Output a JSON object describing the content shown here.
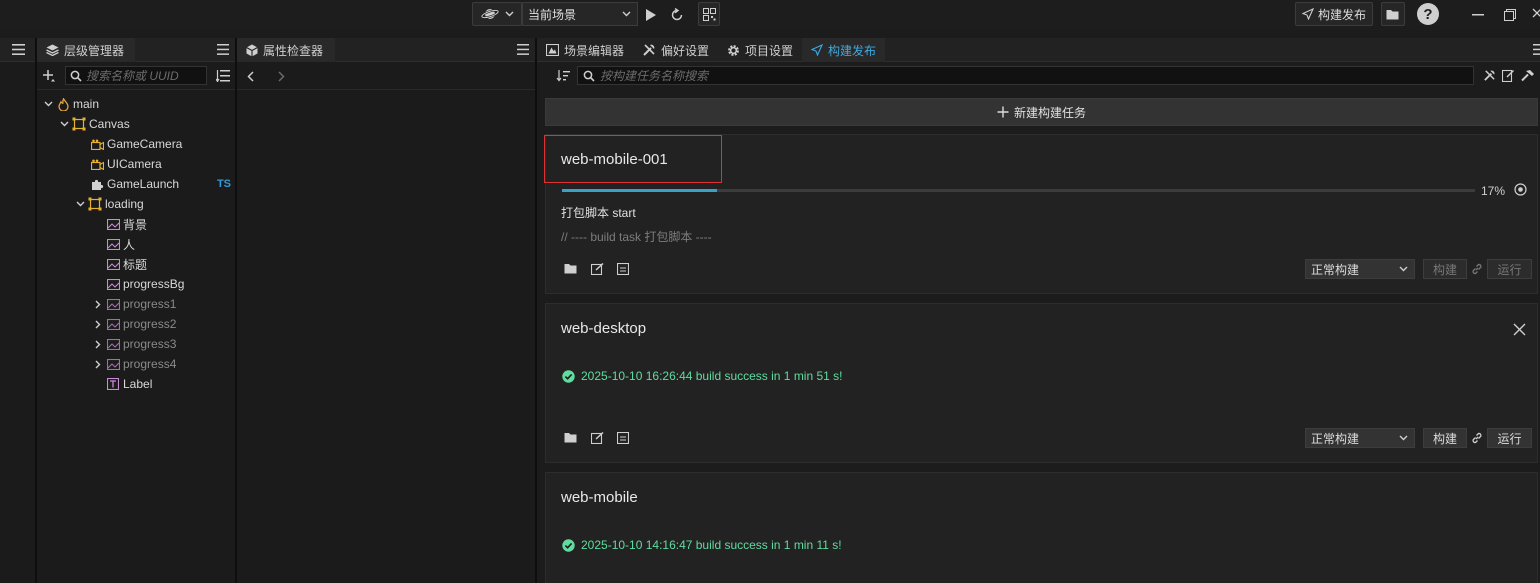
{
  "toolbar": {
    "scene_label": "当前场景",
    "build_publish_label": "构建发布"
  },
  "hierarchy": {
    "tab_label": "层级管理器",
    "search_placeholder": "搜索名称或 UUID",
    "nodes": [
      {
        "label": "main",
        "icon": "fire-icon"
      },
      {
        "label": "Canvas",
        "icon": "canvas-icon"
      },
      {
        "label": "GameCamera",
        "icon": "camera-icon"
      },
      {
        "label": "UICamera",
        "icon": "camera-icon"
      },
      {
        "label": "GameLaunch",
        "icon": "puzzle-icon",
        "badge": "TS"
      },
      {
        "label": "loading",
        "icon": "canvas-icon"
      },
      {
        "label": "背景",
        "icon": "image-icon"
      },
      {
        "label": "人",
        "icon": "image-icon"
      },
      {
        "label": "标题",
        "icon": "image-icon"
      },
      {
        "label": "progressBg",
        "icon": "image-icon"
      },
      {
        "label": "progress1",
        "icon": "image-icon"
      },
      {
        "label": "progress2",
        "icon": "image-icon"
      },
      {
        "label": "progress3",
        "icon": "image-icon"
      },
      {
        "label": "progress4",
        "icon": "image-icon"
      },
      {
        "label": "Label",
        "icon": "text-icon"
      }
    ]
  },
  "inspector": {
    "tab_label": "属性检查器"
  },
  "main_tabs": [
    {
      "label": "场景编辑器"
    },
    {
      "label": "偏好设置"
    },
    {
      "label": "项目设置"
    },
    {
      "label": "构建发布"
    }
  ],
  "build": {
    "search_placeholder": "按构建任务名称搜索",
    "new_task_label": "新建构建任务",
    "tasks": [
      {
        "name": "web-mobile-001",
        "progress_text": "17%",
        "progress": 0.17,
        "status_line": "打包脚本 start",
        "log_line": "// ---- build task 打包脚本 ----",
        "mode": "正常构建",
        "build_label": "构建",
        "run_label": "运行"
      },
      {
        "name": "web-desktop",
        "message": "2025-10-10 16:26:44 build success in 1 min 51 s!",
        "mode": "正常构建",
        "build_label": "构建",
        "run_label": "运行"
      },
      {
        "name": "web-mobile",
        "message": "2025-10-10 14:16:47 build success in 1 min 11 s!"
      }
    ]
  },
  "colors": {
    "accent": "#2f9bd6",
    "progress_fill": "#3aa0c8",
    "success": "#5fdc9e",
    "highlight_box": "#e03232"
  }
}
